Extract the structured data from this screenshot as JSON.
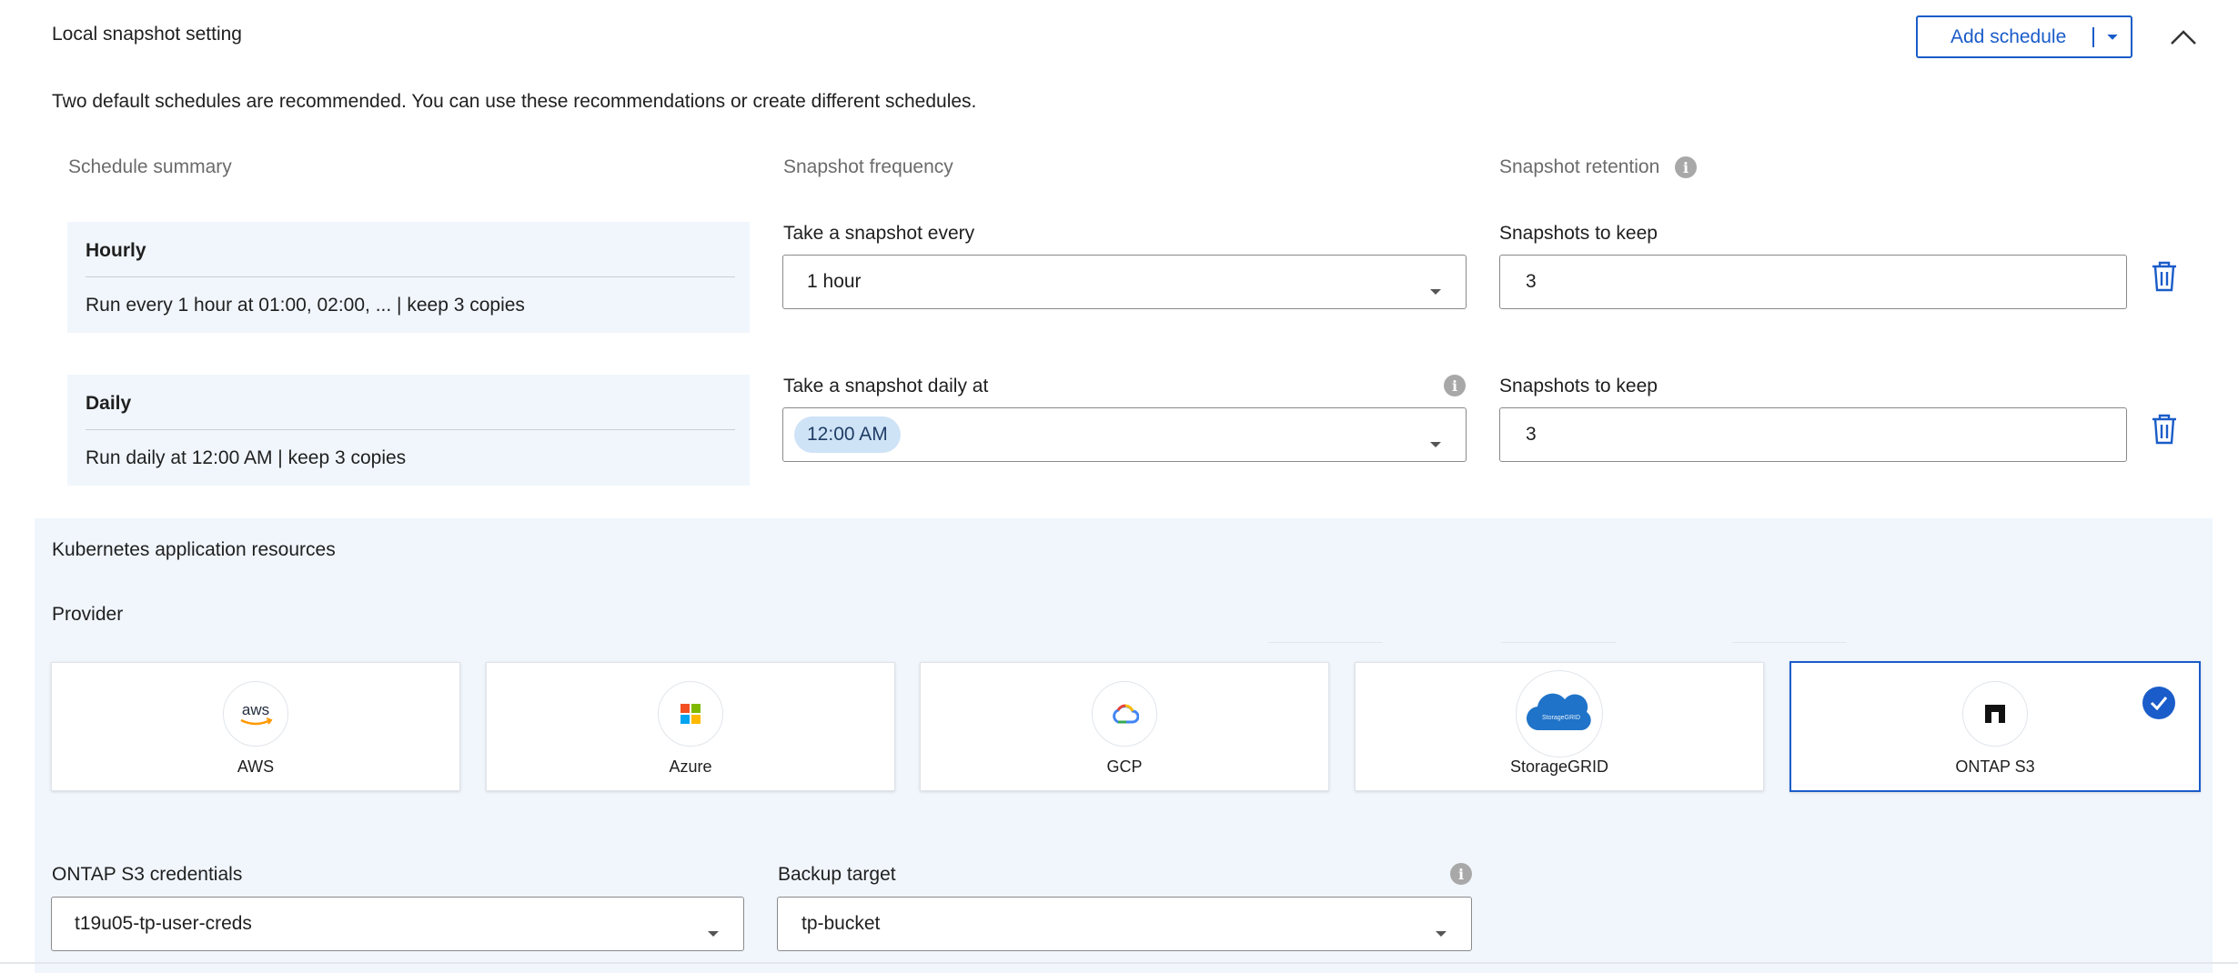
{
  "header": {
    "title": "Local snapshot setting",
    "add_schedule_label": "Add schedule",
    "intro": "Two default schedules are recommended. You can use these recommendations or create different schedules."
  },
  "columns": {
    "summary": "Schedule summary",
    "frequency": "Snapshot frequency",
    "retention": "Snapshot retention"
  },
  "schedules": [
    {
      "name": "Hourly",
      "description": "Run every 1 hour at 01:00, 02:00, ... | keep 3 copies",
      "frequency_label": "Take a snapshot every",
      "frequency_value": "1 hour",
      "keep_label": "Snapshots to keep",
      "keep_value": "3"
    },
    {
      "name": "Daily",
      "description": "Run daily at 12:00 AM | keep 3 copies",
      "frequency_label": "Take a snapshot daily at",
      "frequency_value": "12:00 AM",
      "keep_label": "Snapshots to keep",
      "keep_value": "3"
    }
  ],
  "kubernetes": {
    "title": "Kubernetes application resources",
    "provider_label": "Provider",
    "providers": [
      {
        "name": "AWS",
        "icon": "aws-logo-icon",
        "selected": false
      },
      {
        "name": "Azure",
        "icon": "azure-logo-icon",
        "selected": false
      },
      {
        "name": "GCP",
        "icon": "gcp-logo-icon",
        "selected": false
      },
      {
        "name": "StorageGRID",
        "icon": "storagegrid-logo-icon",
        "selected": false
      },
      {
        "name": "ONTAP S3",
        "icon": "ontap-logo-icon",
        "selected": true
      }
    ],
    "credentials_label": "ONTAP S3 credentials",
    "credentials_value": "t19u05-tp-user-creds",
    "backup_target_label": "Backup target",
    "backup_target_value": "tp-bucket"
  },
  "colors": {
    "accent": "#1a5cc9",
    "panel": "#f0f6fc",
    "chip": "#cfe3f7"
  }
}
